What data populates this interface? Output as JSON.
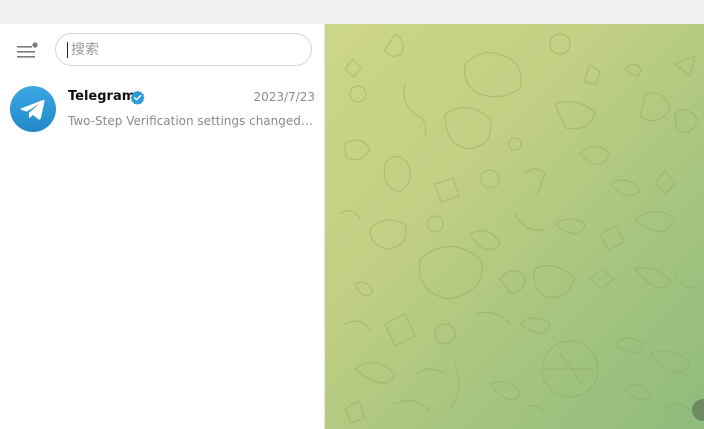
{
  "window": {
    "title_bar": ""
  },
  "sidebar": {
    "menu_icon": "hamburger-menu-icon",
    "search": {
      "placeholder": "搜索",
      "value": ""
    },
    "chats": [
      {
        "name": "Telegram",
        "verified": true,
        "date": "2023/7/23",
        "preview": "Two-Step Verification settings changed. Your account is protected",
        "avatar_icon": "telegram-plane-icon"
      }
    ]
  },
  "chat_area": {
    "background": "doodle-pattern-wallpaper"
  },
  "colors": {
    "accent": "#2a9ad8",
    "sidebar_bg": "#ffffff",
    "wallpaper_start": "#cdd68a",
    "wallpaper_end": "#8fbb7e"
  }
}
